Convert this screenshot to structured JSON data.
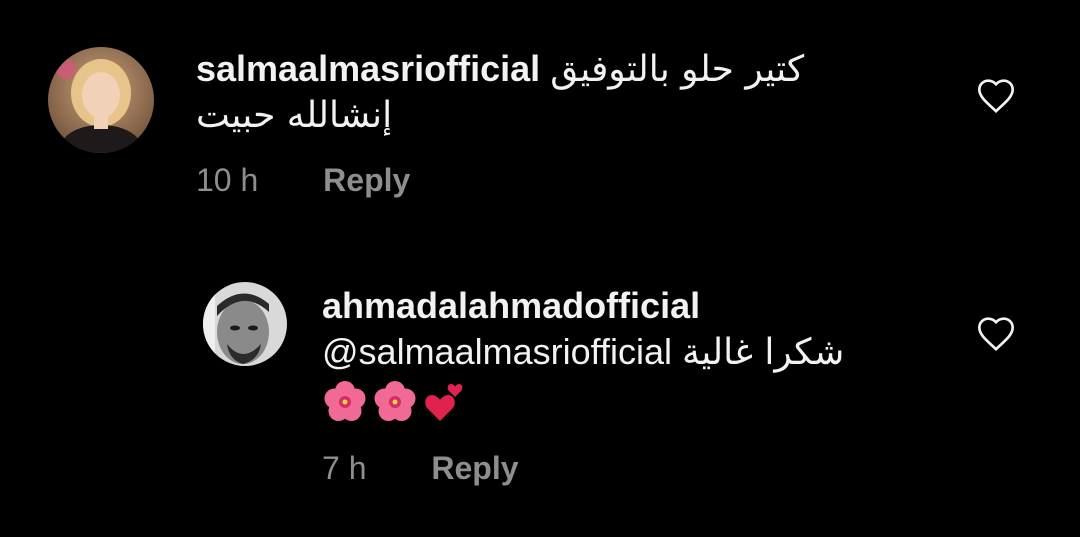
{
  "comments": [
    {
      "username": "salmaalmasriofficial",
      "text_line1": "كتير حلو بالتوفيق",
      "text_line2": "إنشالله حبيت",
      "time": "10 h",
      "reply_label": "Reply",
      "avatar_icon": "profile-photo-woman",
      "like_icon": "heart-outline-icon"
    },
    {
      "username": "ahmadalahmadofficial",
      "mention": "@salmaalmasriofficial",
      "text_arabic": "شكرا غالية",
      "emojis": [
        "hibiscus-icon",
        "hibiscus-icon",
        "two-hearts-icon"
      ],
      "time": "7 h",
      "reply_label": "Reply",
      "avatar_icon": "profile-photo-man",
      "like_icon": "heart-outline-icon"
    }
  ],
  "colors": {
    "background": "#000000",
    "text": "#f2f2f2",
    "meta": "#8e8e8e",
    "emoji_pink": "#f25a8f",
    "heart_red": "#e0234e"
  }
}
